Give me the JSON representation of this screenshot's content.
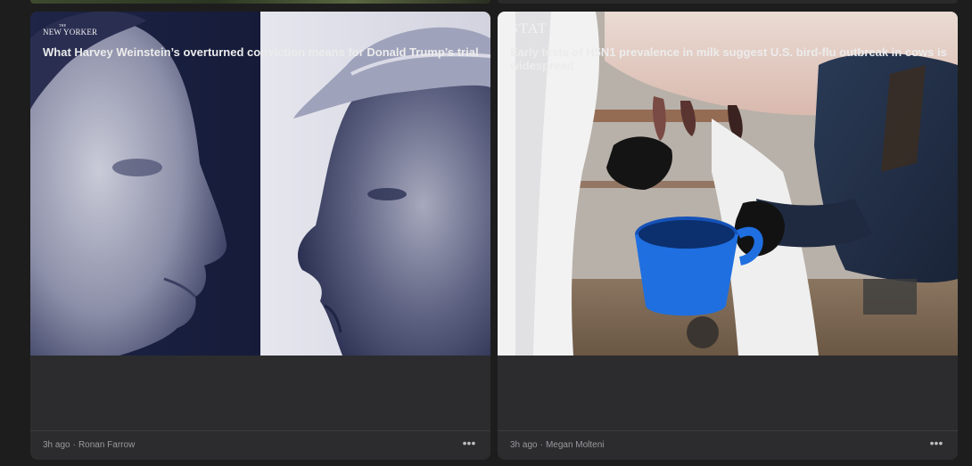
{
  "cards": [
    {
      "publisher": "NEW YORKER",
      "publisher_small": "THE",
      "headline": "What Harvey Weinstein’s overturned conviction means for Donald Trump’s trial",
      "time": "3h ago",
      "separator": "·",
      "author": "Ronan Farrow",
      "more_label": "•••"
    },
    {
      "publisher": "STAT",
      "headline": "Early tests of H5N1 prevalence in milk suggest U.S. bird-flu outbreak in cows is widespread",
      "time": "3h ago",
      "separator": "·",
      "author": "Megan Molteni",
      "more_label": "•••"
    }
  ],
  "icons": {
    "more": "ellipsis-icon"
  },
  "colors": {
    "background": "#1d1d1d",
    "card": "#2c2c2e",
    "headline": "#ececec",
    "meta": "#9a9a9e",
    "cup_blue": "#1f6fe0"
  }
}
